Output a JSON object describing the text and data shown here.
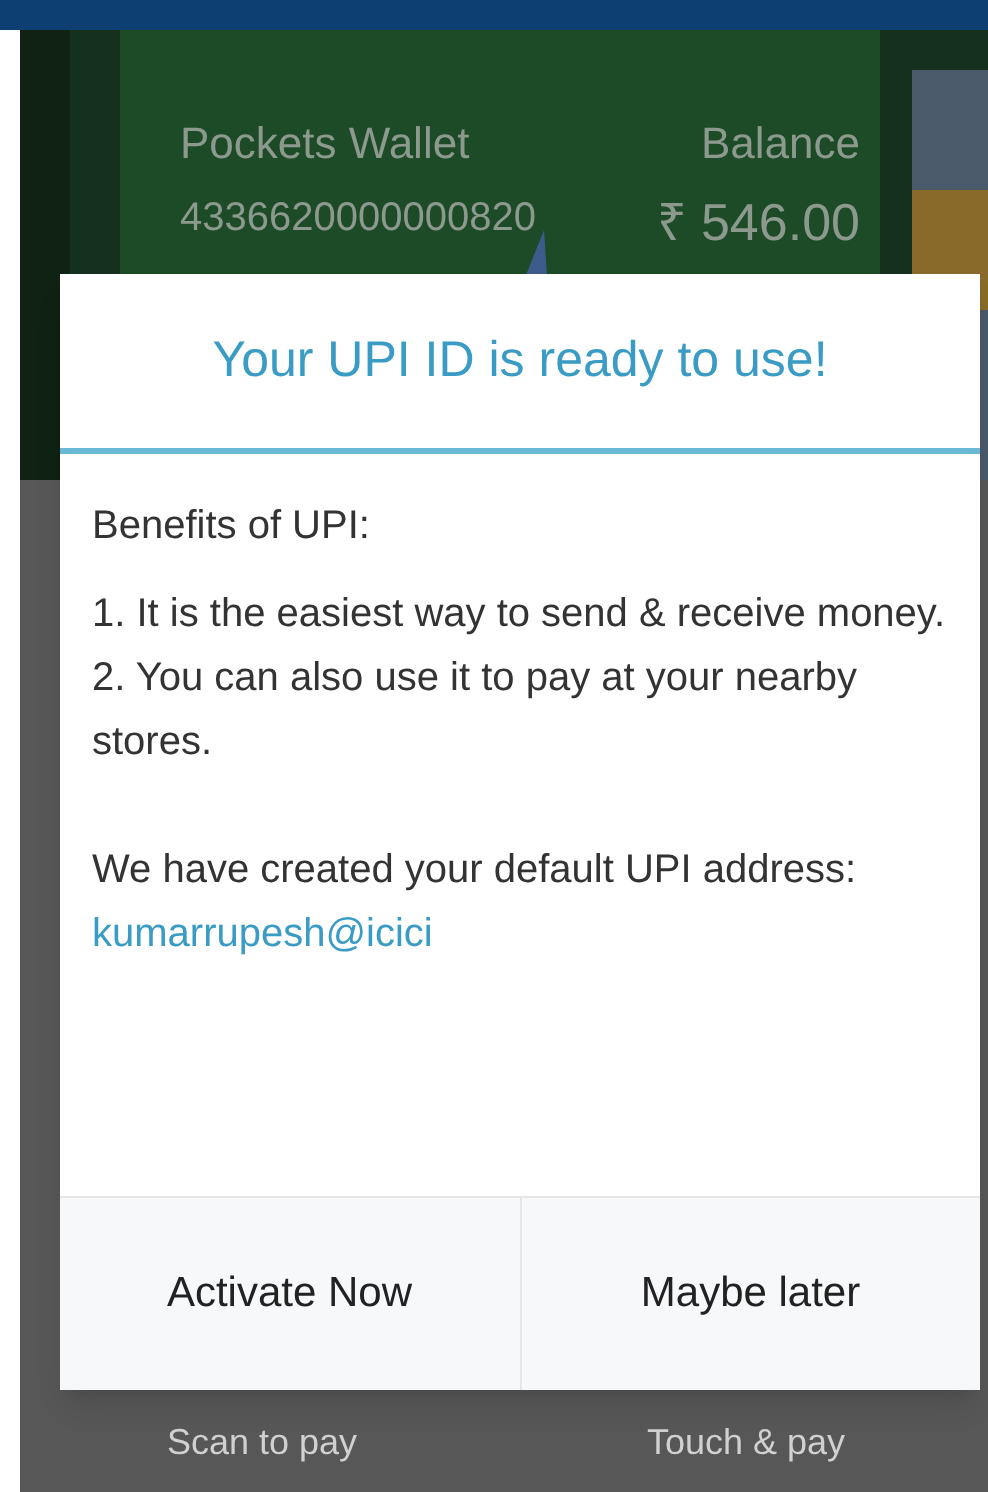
{
  "background": {
    "wallet_name": "Pockets Wallet",
    "card_number": "4336620000000820",
    "balance_label": "Balance",
    "balance": "₹ 546.00",
    "actions": [
      "Scan to pay",
      "Touch & pay"
    ]
  },
  "dialog": {
    "title": "Your UPI ID is ready to use!",
    "heading": "Benefits of UPI:",
    "benefits": [
      "1. It is the easiest way to send & receive money.",
      "2. You can also use it to pay at your nearby stores."
    ],
    "note": "We have created your default UPI address:",
    "upi_id": "kumarrupesh@icici",
    "buttons": [
      "Activate Now",
      "Maybe later"
    ]
  }
}
